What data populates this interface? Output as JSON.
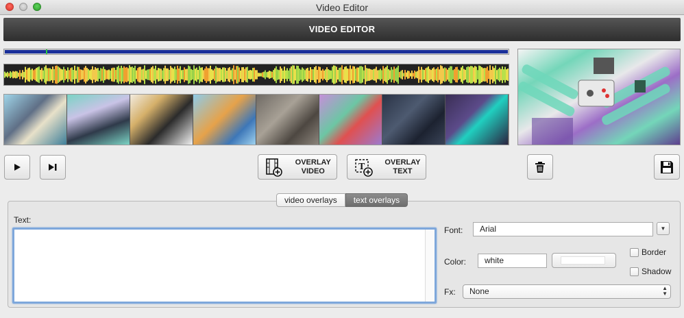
{
  "window": {
    "title": "Video Editor"
  },
  "header": {
    "title": "VIDEO EDITOR"
  },
  "timeline": {
    "progress": 1.0,
    "playhead": 0.083
  },
  "filmstrip": {
    "frame_count": 8
  },
  "controls": {
    "play_icon": "play-icon",
    "step_icon": "step-forward-icon",
    "overlay_video_line1": "OVERLAY",
    "overlay_video_line2": "VIDEO",
    "overlay_text_line1": "OVERLAY",
    "overlay_text_line2": "TEXT",
    "delete_icon": "trash-icon",
    "save_icon": "floppy-disk-icon"
  },
  "tabs": [
    {
      "label": "video overlays",
      "active": false
    },
    {
      "label": "text overlays",
      "active": true
    }
  ],
  "form": {
    "text_label": "Text:",
    "text_value": "",
    "font_label": "Font:",
    "font_value": "Arial",
    "color_label": "Color:",
    "color_value": "white",
    "border_label": "Border",
    "border_checked": false,
    "shadow_label": "Shadow",
    "shadow_checked": false,
    "fx_label": "Fx:",
    "fx_value": "None"
  },
  "colors": {
    "header_bg": "#3a3a3a",
    "progress_fill": "#1a2f9a",
    "playhead": "#2ecc40",
    "focus_ring": "#7ea7db",
    "active_tab": "#7a7a7a"
  }
}
